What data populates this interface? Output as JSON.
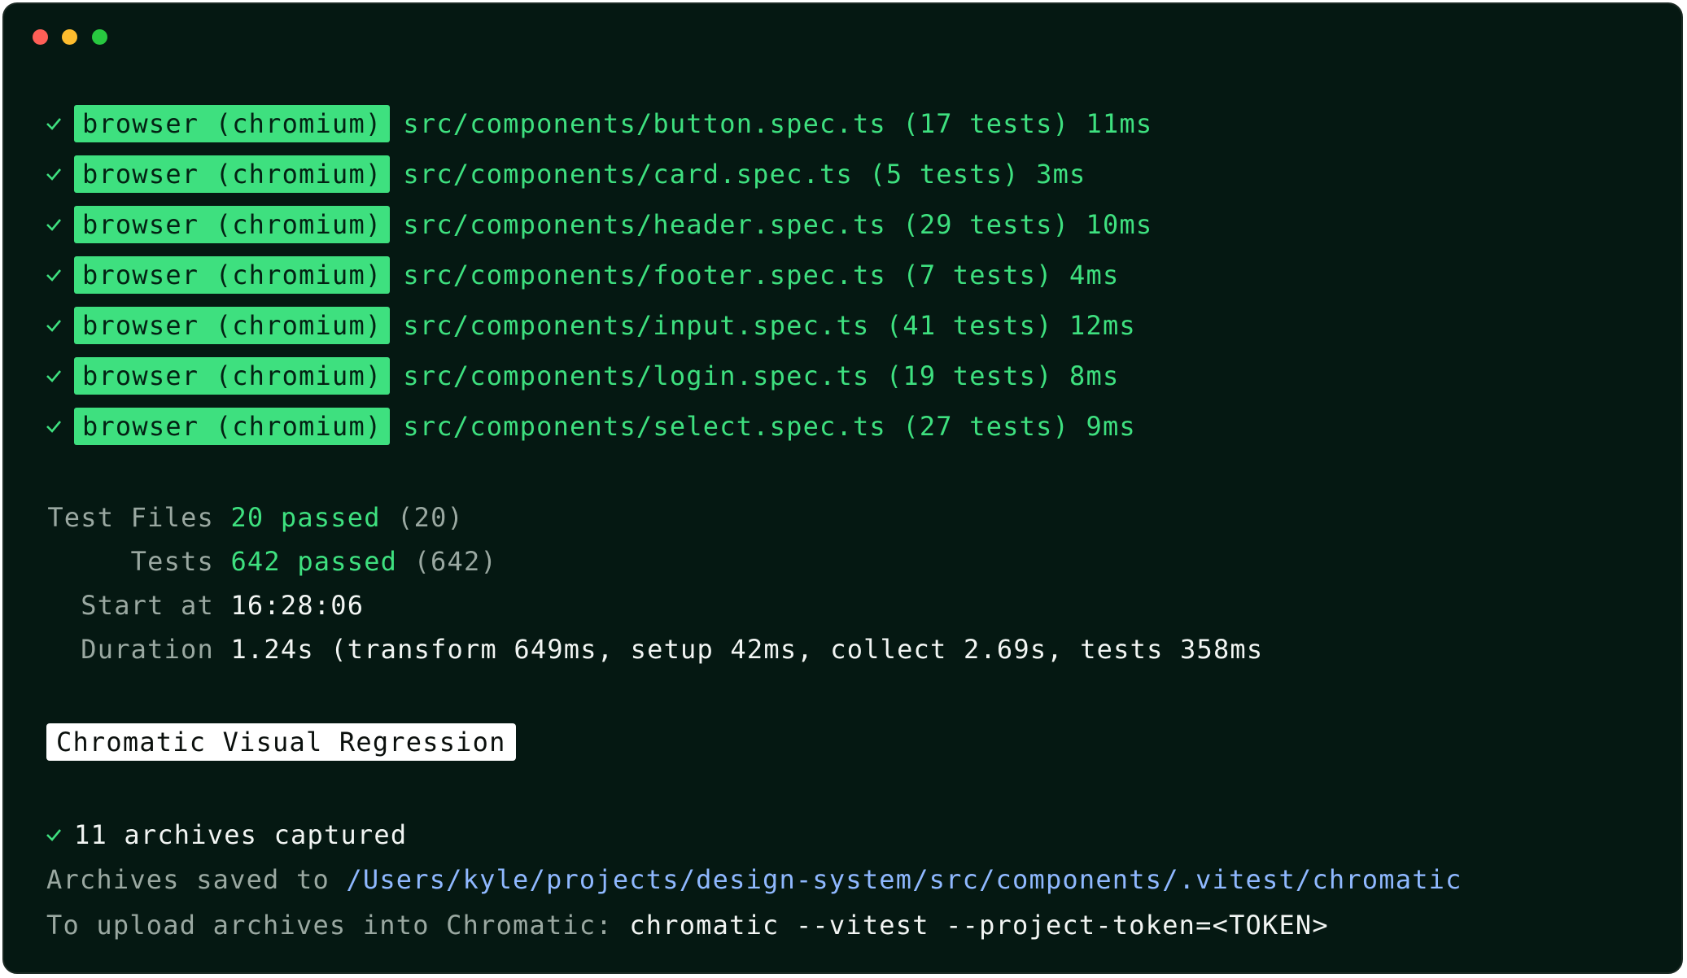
{
  "window": {
    "title_buttons": [
      "close",
      "minimize",
      "maximize"
    ],
    "colors": {
      "background": "#051812",
      "accent_green": "#3ee07f",
      "path_blue": "#8fb8ff"
    }
  },
  "test_results": [
    {
      "badge": "browser (chromium)",
      "file": "src/components/button.spec.ts",
      "count": "(17 tests)",
      "time": "11ms"
    },
    {
      "badge": "browser (chromium)",
      "file": "src/components/card.spec.ts",
      "count": "(5 tests)",
      "time": "3ms"
    },
    {
      "badge": "browser (chromium)",
      "file": "src/components/header.spec.ts",
      "count": "(29 tests)",
      "time": "10ms"
    },
    {
      "badge": "browser (chromium)",
      "file": "src/components/footer.spec.ts",
      "count": "(7 tests)",
      "time": "4ms"
    },
    {
      "badge": "browser (chromium)",
      "file": "src/components/input.spec.ts",
      "count": "(41 tests)",
      "time": "12ms"
    },
    {
      "badge": "browser (chromium)",
      "file": "src/components/login.spec.ts",
      "count": "(19 tests)",
      "time": "8ms"
    },
    {
      "badge": "browser (chromium)",
      "file": "src/components/select.spec.ts",
      "count": "(27 tests)",
      "time": "9ms"
    }
  ],
  "summary": {
    "test_files": {
      "label": "Test Files",
      "passed": "20 passed",
      "total": "(20)"
    },
    "tests": {
      "label": "Tests",
      "passed": "642 passed",
      "total": "(642)"
    },
    "start": {
      "label": "Start at",
      "value": "16:28:06"
    },
    "duration": {
      "label": "Duration",
      "value": "1.24s (transform 649ms, setup 42ms, collect 2.69s, tests 358ms"
    }
  },
  "chromatic": {
    "heading": "Chromatic Visual Regression",
    "captured": "11 archives captured",
    "saved_label": "Archives saved to",
    "saved_path": "/Users/kyle/projects/design-system/src/components/.vitest/chromatic",
    "upload_label": "To upload archives into Chromatic:",
    "upload_command": "chromatic --vitest --project-token=<TOKEN>"
  }
}
